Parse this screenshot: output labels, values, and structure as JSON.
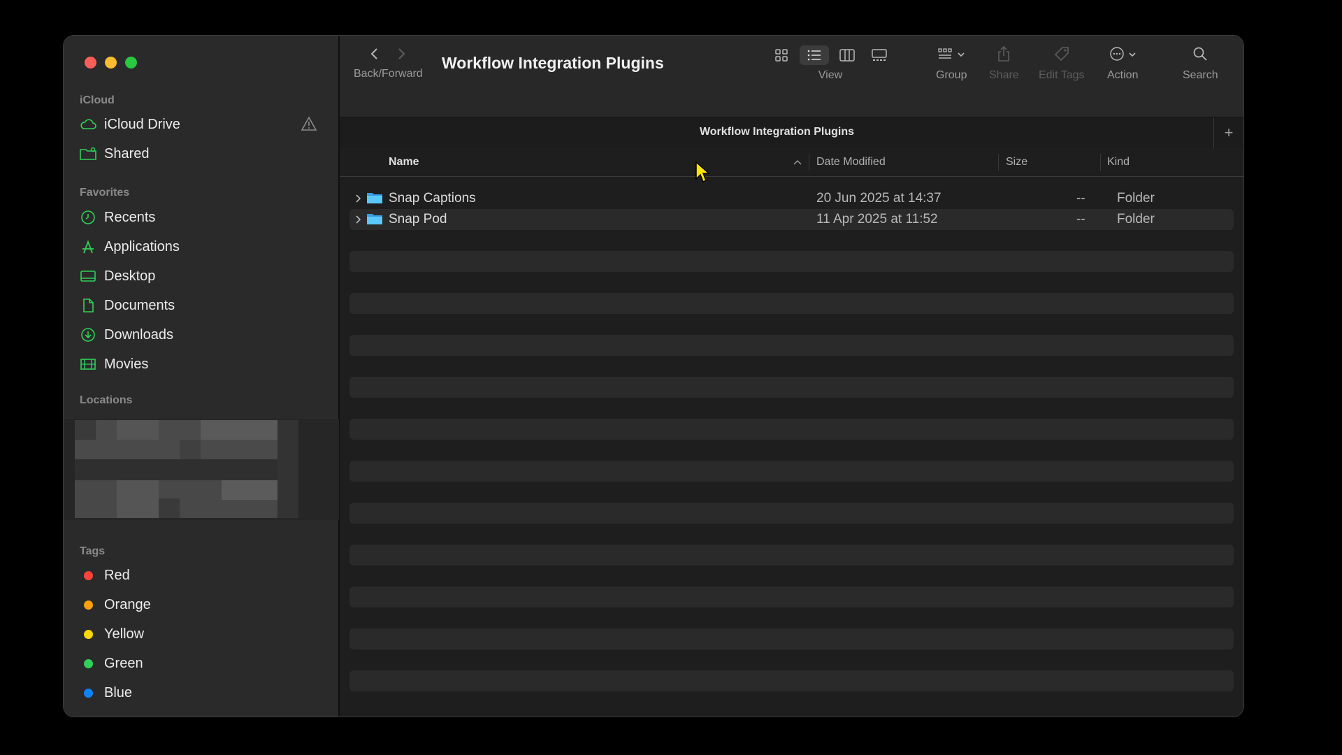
{
  "sidebar": {
    "icloud_title": "iCloud",
    "icloud_items": [
      {
        "label": "iCloud Drive",
        "icon": "cloud-icon"
      },
      {
        "label": "Shared",
        "icon": "shared-folder-icon"
      }
    ],
    "favorites_title": "Favorites",
    "favorites": [
      {
        "label": "Recents",
        "icon": "clock-icon"
      },
      {
        "label": "Applications",
        "icon": "applications-icon"
      },
      {
        "label": "Desktop",
        "icon": "desktop-icon"
      },
      {
        "label": "Documents",
        "icon": "document-icon"
      },
      {
        "label": "Downloads",
        "icon": "download-icon"
      },
      {
        "label": "Movies",
        "icon": "film-icon"
      }
    ],
    "locations_title": "Locations",
    "tags_title": "Tags",
    "tags": [
      {
        "label": "Red",
        "color": "#ff453a"
      },
      {
        "label": "Orange",
        "color": "#ff9f0a"
      },
      {
        "label": "Yellow",
        "color": "#ffd60a"
      },
      {
        "label": "Green",
        "color": "#30d158"
      },
      {
        "label": "Blue",
        "color": "#0a84ff"
      }
    ]
  },
  "toolbar": {
    "title": "Workflow Integration Plugins",
    "back_forward_label": "Back/Forward",
    "view_label": "View",
    "group_label": "Group",
    "share_label": "Share",
    "edit_tags_label": "Edit Tags",
    "action_label": "Action",
    "search_label": "Search"
  },
  "pathbar": {
    "title": "Workflow Integration Plugins",
    "add_label": "+"
  },
  "columns": {
    "name": "Name",
    "date": "Date Modified",
    "size": "Size",
    "kind": "Kind"
  },
  "rows": [
    {
      "name": "Snap Captions",
      "date": "20 Jun 2025 at 14:37",
      "size": "--",
      "kind": "Folder"
    },
    {
      "name": "Snap Pod",
      "date": "11 Apr 2025 at 11:52",
      "size": "--",
      "kind": "Folder"
    }
  ],
  "colors": {
    "accent_green": "#30d158",
    "folder_blue": "#5ac8fa",
    "close": "#ff5f57",
    "minimize": "#febc2e",
    "zoom": "#28c840"
  }
}
